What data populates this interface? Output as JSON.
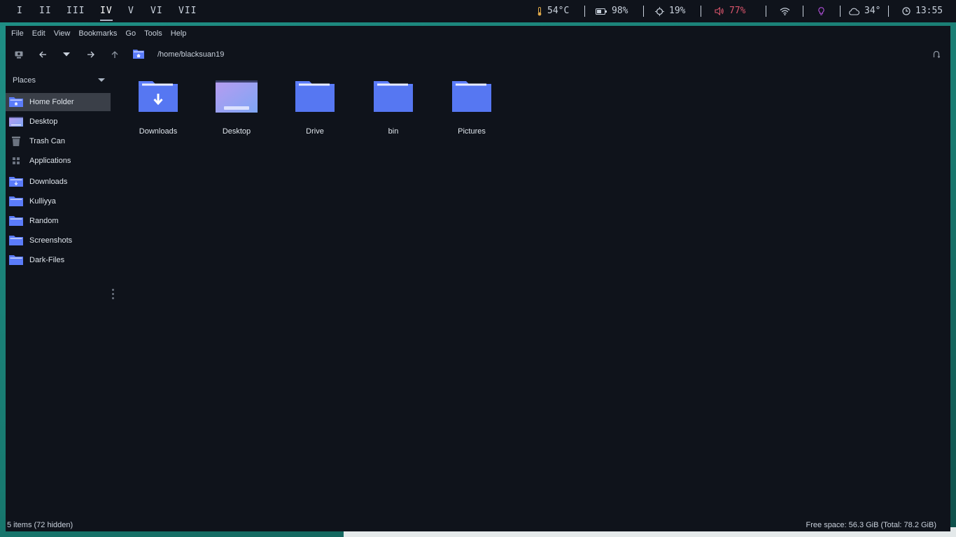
{
  "workspaces": [
    {
      "label": "I",
      "active": false
    },
    {
      "label": "II",
      "active": false
    },
    {
      "label": "III",
      "active": false
    },
    {
      "label": "IV",
      "active": true
    },
    {
      "label": "V",
      "active": false
    },
    {
      "label": "VI",
      "active": false
    },
    {
      "label": "VII",
      "active": false
    }
  ],
  "status": {
    "temperature": {
      "icon": "thermometer-icon",
      "value": "54°C"
    },
    "battery": {
      "icon": "battery-icon",
      "value": "98%"
    },
    "brightness": {
      "icon": "brightness-icon",
      "value": "19%"
    },
    "volume": {
      "icon": "volume-icon",
      "value": "77%",
      "color": "#d9546b"
    },
    "wifi": {
      "icon": "wifi-icon"
    },
    "bulb": {
      "icon": "lightbulb-icon",
      "color": "#b04fd9"
    },
    "weather": {
      "icon": "cloud-icon",
      "value": "34°"
    },
    "clock": {
      "icon": "clock-icon",
      "value": "13:55"
    }
  },
  "menubar": [
    "File",
    "Edit",
    "View",
    "Bookmarks",
    "Go",
    "Tools",
    "Help"
  ],
  "toolbar": {
    "path": "/home/blacksuan19",
    "icons": [
      "computer-icon",
      "back-arrow-icon",
      "history-dropdown-icon",
      "forward-arrow-icon",
      "up-arrow-icon",
      "home-folder-icon",
      "refresh-icon"
    ]
  },
  "sidebar": {
    "header": "Places",
    "items": [
      {
        "label": "Home Folder",
        "icon": "home-folder-icon",
        "selected": true
      },
      {
        "label": "Desktop",
        "icon": "desktop-icon",
        "selected": false
      },
      {
        "label": "Trash Can",
        "icon": "trash-icon",
        "selected": false
      },
      {
        "label": "Applications",
        "icon": "applications-icon",
        "selected": false
      },
      {
        "label": "Downloads",
        "icon": "downloads-folder-icon",
        "selected": false
      },
      {
        "label": "Kulliyya",
        "icon": "folder-icon",
        "selected": false
      },
      {
        "label": "Random",
        "icon": "folder-icon",
        "selected": false
      },
      {
        "label": "Screenshots",
        "icon": "folder-icon",
        "selected": false
      },
      {
        "label": "Dark-Files",
        "icon": "folder-icon",
        "selected": false
      }
    ]
  },
  "files": [
    {
      "name": "Downloads",
      "icon": "downloads-folder-icon"
    },
    {
      "name": "Desktop",
      "icon": "desktop-thumbnail-icon"
    },
    {
      "name": "Drive",
      "icon": "folder-icon"
    },
    {
      "name": "bin",
      "icon": "folder-icon"
    },
    {
      "name": "Pictures",
      "icon": "folder-icon"
    }
  ],
  "statusbar": {
    "items": "5 items (72 hidden)",
    "free_space": "Free space: 56.3 GiB (Total: 78.2 GiB)"
  },
  "colors": {
    "accent_folder": "#5b7cfa",
    "background": "#0f131b",
    "selection": "#3a3f48"
  }
}
